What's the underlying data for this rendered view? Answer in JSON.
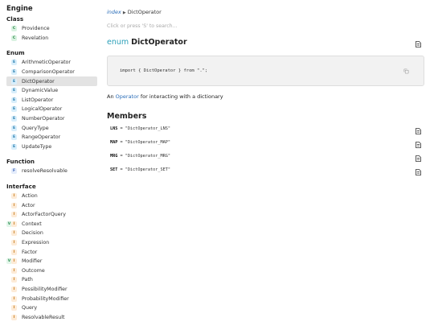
{
  "sidebar": {
    "title": "Engine",
    "groups": [
      {
        "label": "Class",
        "items": [
          {
            "label": "Providence",
            "kind": "C"
          },
          {
            "label": "Revelation",
            "kind": "C"
          }
        ]
      },
      {
        "label": "Enum",
        "items": [
          {
            "label": "ArithmeticOperator",
            "kind": "E"
          },
          {
            "label": "ComparisonOperator",
            "kind": "E"
          },
          {
            "label": "DictOperator",
            "kind": "E",
            "active": true
          },
          {
            "label": "DynamicValue",
            "kind": "E"
          },
          {
            "label": "ListOperator",
            "kind": "E"
          },
          {
            "label": "LogicalOperator",
            "kind": "E"
          },
          {
            "label": "NumberOperator",
            "kind": "E"
          },
          {
            "label": "QueryType",
            "kind": "E"
          },
          {
            "label": "RangeOperator",
            "kind": "E"
          },
          {
            "label": "UpdateType",
            "kind": "E"
          }
        ]
      },
      {
        "label": "Function",
        "items": [
          {
            "label": "resolveResolvable",
            "kind": "F"
          }
        ]
      },
      {
        "label": "Interface",
        "items": [
          {
            "label": "Action",
            "kind": "I"
          },
          {
            "label": "Actor",
            "kind": "I"
          },
          {
            "label": "ActorFactorQuery",
            "kind": "I"
          },
          {
            "label": "Context",
            "kind": "VI"
          },
          {
            "label": "Decision",
            "kind": "I"
          },
          {
            "label": "Expression",
            "kind": "I"
          },
          {
            "label": "Factor",
            "kind": "I"
          },
          {
            "label": "Modifier",
            "kind": "VI"
          },
          {
            "label": "Outcome",
            "kind": "I"
          },
          {
            "label": "Path",
            "kind": "I"
          },
          {
            "label": "PossibilityModifier",
            "kind": "I"
          },
          {
            "label": "ProbabilityModifier",
            "kind": "I"
          },
          {
            "label": "Query",
            "kind": "I"
          },
          {
            "label": "ResolvableResult",
            "kind": "I"
          }
        ]
      }
    ]
  },
  "breadcrumb": {
    "root": "index",
    "current": "DictOperator"
  },
  "search": {
    "placeholder": "Click or press 'S' to search..."
  },
  "heading": {
    "kind": "enum",
    "name": "DictOperator"
  },
  "code": {
    "text": "import { DictOperator } from \".\";"
  },
  "description": {
    "prefix": "An",
    "link": "Operator",
    "suffix": "for interacting with a dictionary"
  },
  "members": {
    "title": "Members",
    "items": [
      {
        "name": "LNS",
        "value": "\"DictOperator_LNS\""
      },
      {
        "name": "MAP",
        "value": "\"DictOperator_MAP\""
      },
      {
        "name": "MRG",
        "value": "\"DictOperator_MRG\""
      },
      {
        "name": "SET",
        "value": "\"DictOperator_SET\""
      }
    ]
  },
  "icons": {
    "source": "source-file-icon",
    "copy": "copy-icon"
  }
}
